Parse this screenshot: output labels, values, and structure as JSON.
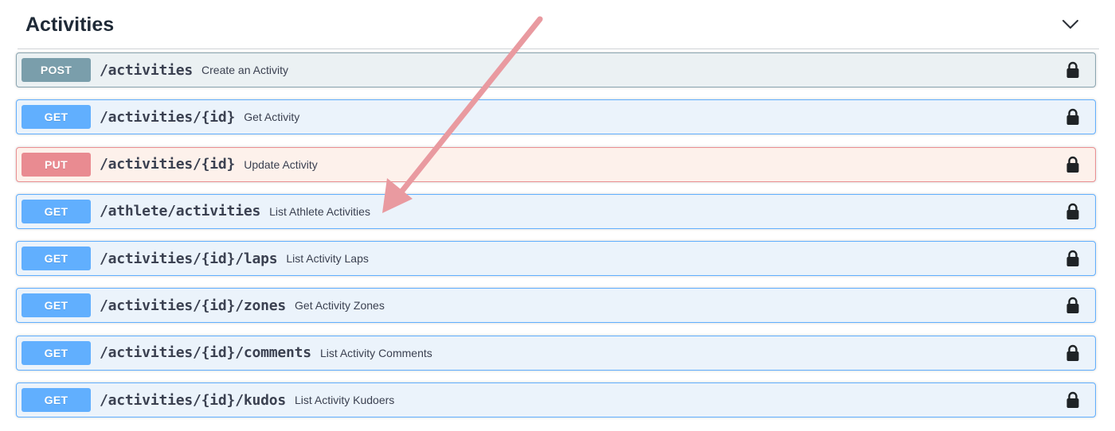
{
  "section": {
    "title": "Activities",
    "toggle_icon": "chevron-down-icon"
  },
  "operations": [
    {
      "method": "POST",
      "path": "/activities",
      "summary": "Create an Activity",
      "locked": true
    },
    {
      "method": "GET",
      "path": "/activities/{id}",
      "summary": "Get Activity",
      "locked": true
    },
    {
      "method": "PUT",
      "path": "/activities/{id}",
      "summary": "Update Activity",
      "locked": true
    },
    {
      "method": "GET",
      "path": "/athlete/activities",
      "summary": "List Athlete Activities",
      "locked": true
    },
    {
      "method": "GET",
      "path": "/activities/{id}/laps",
      "summary": "List Activity Laps",
      "locked": true
    },
    {
      "method": "GET",
      "path": "/activities/{id}/zones",
      "summary": "Get Activity Zones",
      "locked": true
    },
    {
      "method": "GET",
      "path": "/activities/{id}/comments",
      "summary": "List Activity Comments",
      "locked": true
    },
    {
      "method": "GET",
      "path": "/activities/{id}/kudos",
      "summary": "List Activity Kudoers",
      "locked": true
    }
  ],
  "annotation": {
    "type": "arrow",
    "color": "#e99aa0",
    "points_to": "/athlete/activities"
  },
  "colors": {
    "post": "#7a9eab",
    "get": "#61affe",
    "put": "#e98b91"
  }
}
